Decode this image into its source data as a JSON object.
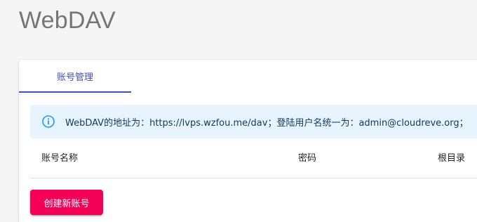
{
  "page": {
    "title": "WebDAV"
  },
  "tabs": [
    {
      "label": "账号管理",
      "active": true
    }
  ],
  "alert": {
    "icon": "info-icon",
    "text": "WebDAV的地址为：https://lvps.wzfou.me/dav；登陆用户名统一为：admin@cloudreve.org；"
  },
  "table": {
    "columns": [
      "账号名称",
      "密码",
      "根目录"
    ]
  },
  "actions": {
    "create_label": "创建新账号"
  },
  "colors": {
    "accent": "#3f51b5",
    "secondary": "#f50057",
    "info_bg": "#e8f4fd",
    "info_icon": "#2196f3",
    "title": "#757575"
  }
}
